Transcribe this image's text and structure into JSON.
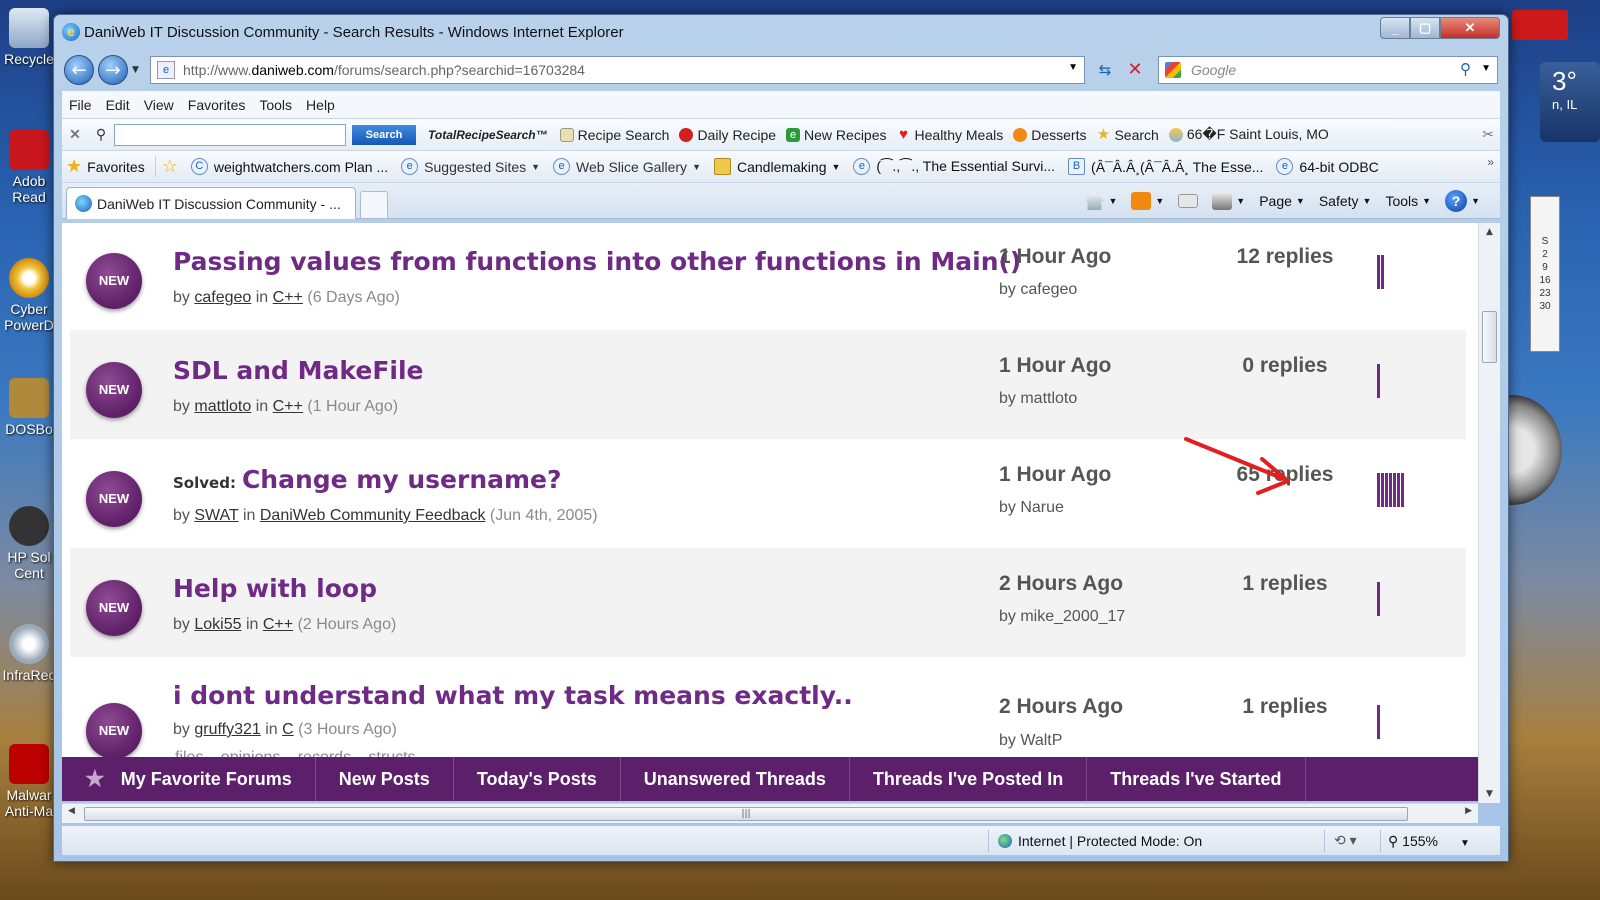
{
  "desktop": {
    "icons": [
      "Recycle",
      "Adob Read",
      "Cyber PowerD",
      "DOSBo",
      "HP Sol Cent",
      "InfraRec",
      "Malwar Anti-Ma"
    ],
    "weather_temp": "3°",
    "weather_city": "n, IL",
    "calendar_days": [
      "S",
      "2",
      "9",
      "16",
      "23",
      "30"
    ]
  },
  "window": {
    "title": "DaniWeb IT Discussion Community - Search Results - Windows Internet Explorer",
    "address_prefix": "http://www.",
    "address_host": "daniweb.com",
    "address_path": "/forums/search.php?searchid=16703284",
    "search_placeholder": "Google"
  },
  "menu": [
    "File",
    "Edit",
    "View",
    "Favorites",
    "Tools",
    "Help"
  ],
  "toolbar": {
    "search_button": "Search",
    "logo": "TotalRecipeSearch™",
    "items": [
      "Recipe Search",
      "Daily Recipe",
      "New Recipes",
      "Healthy Meals",
      "Desserts",
      "Search",
      "66�F Saint Louis, MO"
    ]
  },
  "favorites": {
    "label": "Favorites",
    "items": [
      "weightwatchers.com Plan ...",
      "Suggested Sites",
      "Web Slice Gallery",
      "Candlemaking",
      "(⁀.,⁀., The Essential Survi...",
      "(Â¯Â.Â¸(Â¯Â.Â¸ The Esse...",
      "64-bit ODBC"
    ]
  },
  "tab": {
    "title": "DaniWeb IT Discussion Community - ..."
  },
  "commands": [
    "Page",
    "Safety",
    "Tools"
  ],
  "threads": [
    {
      "badge": "NEW",
      "solved": "",
      "title": "Passing values from functions into other functions in Main()",
      "by": "by",
      "author": "cafegeo",
      "in": "in",
      "forum": "C++",
      "age": "(6 Days Ago)",
      "time": "1 Hour Ago",
      "last_by": "by cafegeo",
      "replies": "12 replies",
      "reply_count": 12,
      "tags": ""
    },
    {
      "badge": "NEW",
      "solved": "",
      "title": "SDL and MakeFile",
      "by": "by",
      "author": "mattloto",
      "in": "in",
      "forum": "C++",
      "age": "(1 Hour Ago)",
      "time": "1 Hour Ago",
      "last_by": "by mattloto",
      "replies": "0 replies",
      "reply_count": 0,
      "tags": ""
    },
    {
      "badge": "NEW",
      "solved": "Solved:",
      "title": "Change my username?",
      "by": "by",
      "author": "SWAT",
      "in": "in",
      "forum": "DaniWeb Community Feedback",
      "age": "(Jun 4th, 2005)",
      "time": "1 Hour Ago",
      "last_by": "by Narue",
      "replies": "65 replies",
      "reply_count": 65,
      "tags": ""
    },
    {
      "badge": "NEW",
      "solved": "",
      "title": "Help with loop",
      "by": "by",
      "author": "Loki55",
      "in": "in",
      "forum": "C++",
      "age": "(2 Hours Ago)",
      "time": "2 Hours Ago",
      "last_by": "by mike_2000_17",
      "replies": "1 replies",
      "reply_count": 1,
      "tags": ""
    },
    {
      "badge": "NEW",
      "solved": "",
      "title": "i dont understand what my task means exactly..",
      "by": "by",
      "author": "gruffy321",
      "in": "in",
      "forum": "C",
      "age": "(3 Hours Ago)",
      "time": "2 Hours Ago",
      "last_by": "by WaltP",
      "replies": "1 replies",
      "reply_count": 1,
      "tags": "files . opinions . records . structs"
    }
  ],
  "bottom_nav": [
    "My Favorite Forums",
    "New Posts",
    "Today's Posts",
    "Unanswered Threads",
    "Threads I've Posted In",
    "Threads I've Started"
  ],
  "status": {
    "zone": "Internet | Protected Mode: On",
    "zoom": "155%"
  },
  "colors": {
    "accent": "#6f2a85",
    "nav_bg": "#5c1f6a",
    "arrow": "#e02020"
  }
}
